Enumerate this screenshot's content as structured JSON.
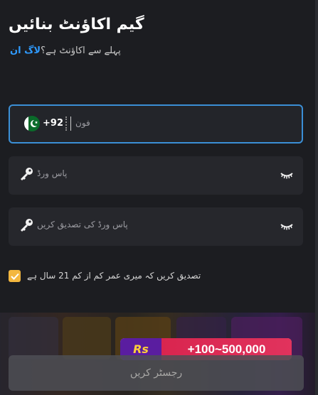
{
  "header": {
    "title": "گیم اکاؤنٹ بنائیں",
    "subtitle": "پہلے سے اکاؤنٹ ہے؟",
    "login_link": "لاگ ان"
  },
  "phone": {
    "country_code": "+92",
    "placeholder": "فون",
    "flag": "pakistan-flag"
  },
  "password": {
    "placeholder": "پاس ورڈ",
    "icon": "key-icon",
    "toggle_icon": "eye-closed-icon"
  },
  "confirm_password": {
    "placeholder": "پاس ورڈ کی تصدیق کریں",
    "icon": "key-icon",
    "toggle_icon": "eye-closed-icon"
  },
  "age_check": {
    "checked": true,
    "label": "تصدیق کریں کہ میری عمر کم از کم 21 سال ہے"
  },
  "promo": {
    "currency": "Rs",
    "amount": "+100~500,000"
  },
  "register_button": {
    "label": "رجسٹر کریں"
  },
  "colors": {
    "background": "#1c1d21",
    "accent_blue": "#2f9bff",
    "checkbox": "#f3b73f",
    "promo_red": "#d9254f",
    "promo_purple": "#5a1da0"
  }
}
